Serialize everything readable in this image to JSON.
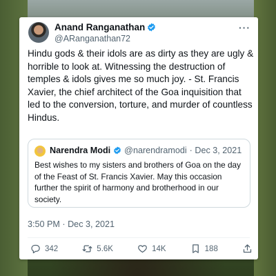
{
  "tweet": {
    "author_name": "Anand Ranganathan",
    "author_handle": "@ARanganathan72",
    "more_label": "···",
    "text": "Hindu gods & their idols are as dirty as they are ugly & horrible to look at. Witnessing the destruction of temples & idols gives me so much joy. - St. Francis Xavier, the chief architect of the Goa inquisition that led to the conversion, torture, and murder of countless Hindus.",
    "timestamp": "3:50 PM · Dec 3, 2021"
  },
  "quoted_tweet": {
    "author_name": "Narendra Modi",
    "author_handle": "@narendramodi",
    "date": "· Dec 3, 2021",
    "text": "Best wishes to my sisters and brothers of Goa on the day of the Feast of St. Francis Xavier. May this occasion further the spirit of harmony and brotherhood in our society."
  },
  "actions": {
    "replies": "342",
    "retweets": "5.6K",
    "likes": "14K",
    "bookmarks": "188"
  },
  "colors": {
    "verified_blue": "#1d9bf0",
    "text_primary": "#0f1419",
    "text_secondary": "#536471"
  },
  "icons": {
    "reply": "reply-icon",
    "retweet": "retweet-icon",
    "like": "heart-icon",
    "bookmark": "bookmark-icon",
    "share": "share-icon",
    "verified": "verified-badge-icon"
  }
}
